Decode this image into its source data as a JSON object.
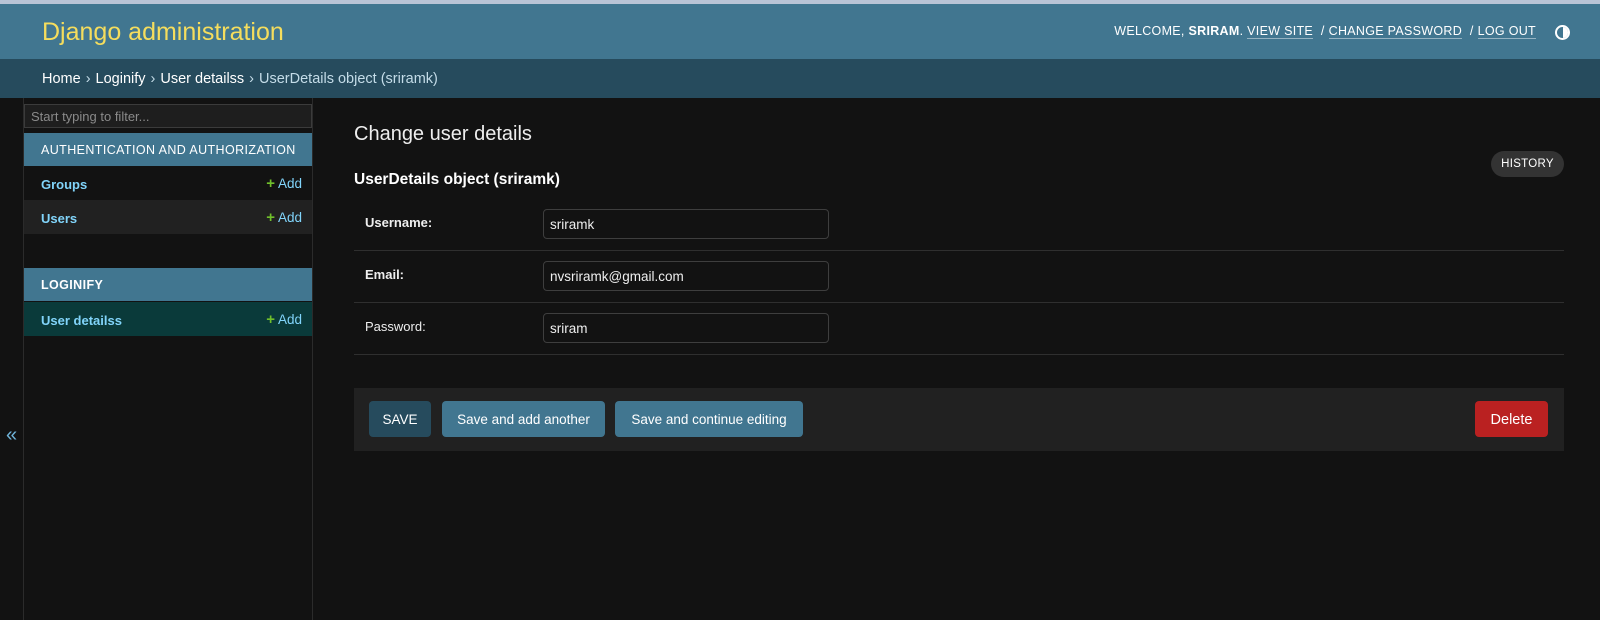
{
  "header": {
    "brand": "Django administration",
    "welcome_prefix": "WELCOME,",
    "username": "SRIRAM",
    "view_site": "VIEW SITE",
    "change_password": "CHANGE PASSWORD",
    "log_out": "LOG OUT",
    "separator": "/",
    "theme_icon": "theme-toggle-icon"
  },
  "breadcrumbs": {
    "items": [
      "Home",
      "Loginify",
      "User detailss",
      "UserDetails object (sriramk)"
    ],
    "separator": "›"
  },
  "sidebar": {
    "filter_placeholder": "Start typing to filter...",
    "collapse_glyph": "«",
    "modules": [
      {
        "title": "AUTHENTICATION AND AUTHORIZATION",
        "models": [
          {
            "label": "Groups",
            "add_label": "Add"
          },
          {
            "label": "Users",
            "add_label": "Add"
          }
        ]
      },
      {
        "title": "LOGINIFY",
        "models": [
          {
            "label": "User detailss",
            "add_label": "Add",
            "selected": true
          }
        ]
      }
    ]
  },
  "main": {
    "page_title": "Change user details",
    "history_button": "HISTORY",
    "object_title": "UserDetails object (sriramk)",
    "fields": [
      {
        "label": "Username:",
        "value": "sriramk",
        "required": true
      },
      {
        "label": "Email:",
        "value": "nvsriramk@gmail.com",
        "required": true
      },
      {
        "label": "Password:",
        "value": "sriram",
        "required": false
      }
    ],
    "buttons": {
      "save": "SAVE",
      "save_add_another": "Save and add another",
      "save_continue": "Save and continue editing",
      "delete": "Delete"
    }
  },
  "colors": {
    "header_bg": "#417690",
    "breadcrumbs_bg": "#264b5d",
    "brand_text": "#f5dd5d",
    "link": "#81d4fa",
    "add_plus": "#70bf2b",
    "delete_bg": "#ba2121",
    "page_bg": "#121212"
  }
}
